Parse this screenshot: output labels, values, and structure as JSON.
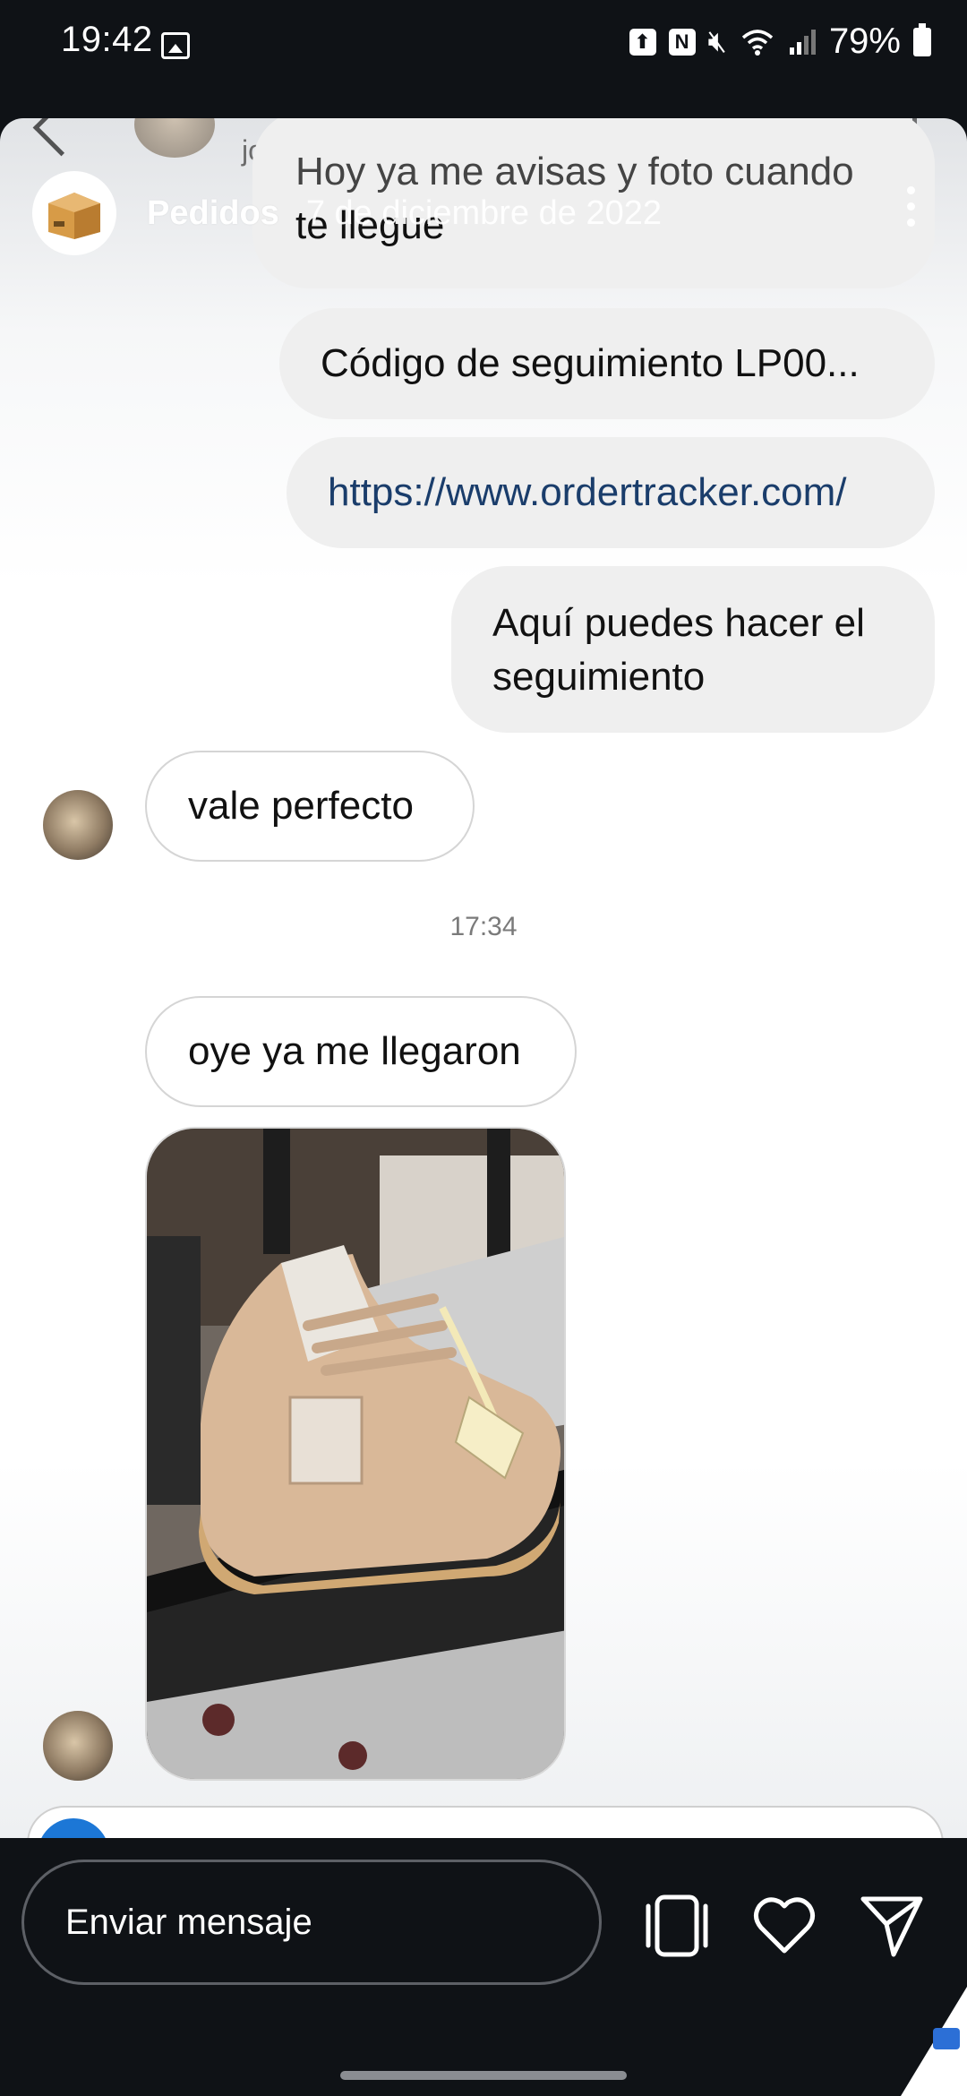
{
  "status_bar": {
    "time": "19:42",
    "battery": "79%",
    "icons": [
      "image-icon",
      "upload-icon",
      "nfc-icon",
      "mute-icon",
      "wifi-icon",
      "signal-icon",
      "battery-icon"
    ]
  },
  "chat_header_ghost": {
    "username": "joseluis_grcia",
    "icons": [
      "back-icon",
      "phone-icon",
      "video-icon"
    ]
  },
  "story_header": {
    "title": "Pedidos",
    "date": "7 de diciembre de 2022",
    "avatar_icon": "package-box-icon",
    "more_icon": "more-vertical-icon"
  },
  "messages": {
    "m0_line1": "Hoy ya me avisas y foto cuando",
    "m0_line2": "te llegue",
    "m1": "Código de seguimiento LP00...",
    "m2": "https://www.ordertracker.com/",
    "m3_line1": "Aquí puedes hacer el",
    "m3_line2": "seguimiento",
    "m4": "vale perfecto",
    "timestamp": "17:34",
    "m5": "oye ya me llegaron",
    "photo_icon": "sneaker-photo"
  },
  "reply_bar": {
    "placeholder": "Enviar mensaje",
    "icons": [
      "story-frame-icon",
      "heart-icon",
      "send-icon"
    ]
  },
  "colors": {
    "background": "#0f1216",
    "bubble_gray": "#efefef",
    "link": "#1a3d6b",
    "accent_blue": "#1c77d6"
  }
}
